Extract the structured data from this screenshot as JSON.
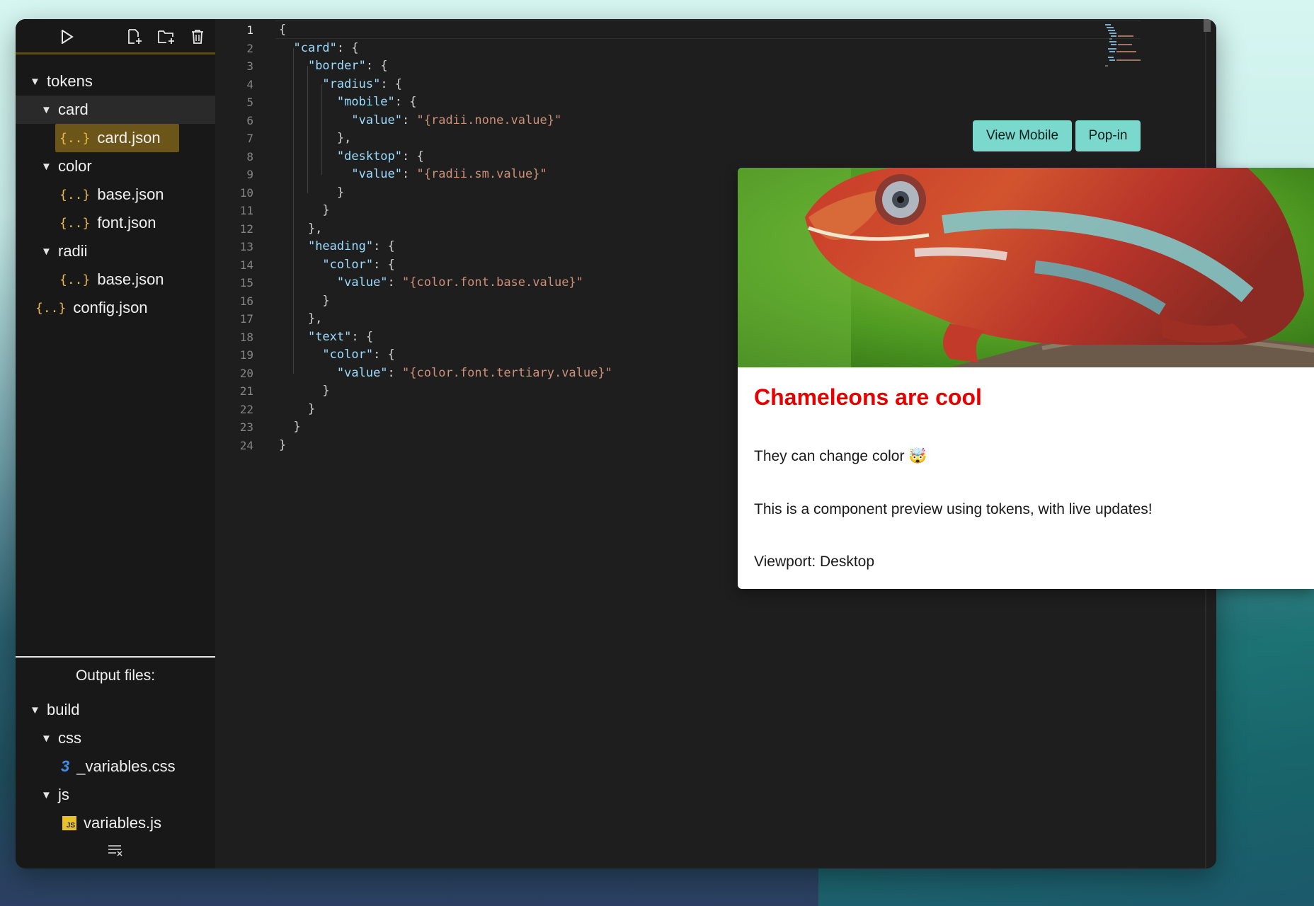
{
  "sidebar": {
    "tokens_folder": "tokens",
    "card_folder": "card",
    "card_file": "card.json",
    "color_folder": "color",
    "color_base": "base.json",
    "color_font": "font.json",
    "radii_folder": "radii",
    "radii_base": "base.json",
    "config_file": "config.json",
    "json_icon": "{..}"
  },
  "output": {
    "title": "Output files:",
    "build_folder": "build",
    "css_folder": "css",
    "css_file": "_variables.css",
    "js_folder": "js",
    "js_file": "variables.js",
    "js_badge": "JS"
  },
  "editor": {
    "active_line": 1,
    "lines": [
      "1",
      "2",
      "3",
      "4",
      "5",
      "6",
      "7",
      "8",
      "9",
      "10",
      "11",
      "12",
      "13",
      "14",
      "15",
      "16",
      "17",
      "18",
      "19",
      "20",
      "21",
      "22",
      "23",
      "24"
    ],
    "code": {
      "card": "\"card\"",
      "border": "\"border\"",
      "radius": "\"radius\"",
      "mobile": "\"mobile\"",
      "value": "\"value\"",
      "v_mobile": "\"{radii.none.value}\"",
      "desktop": "\"desktop\"",
      "v_desktop": "\"{radii.sm.value}\"",
      "heading": "\"heading\"",
      "color": "\"color\"",
      "v_heading": "\"{color.font.base.value}\"",
      "text": "\"text\"",
      "v_text": "\"{color.font.tertiary.value}\""
    }
  },
  "preview": {
    "view_mobile": "View Mobile",
    "pop_in": "Pop-in",
    "title": "Chameleons are cool",
    "line1": "They can change color 🤯",
    "line2": "This is a component preview using tokens, with live updates!",
    "line3": "Viewport: Desktop",
    "colors": {
      "title": "#e60000",
      "button": "#7ad8cc"
    }
  }
}
